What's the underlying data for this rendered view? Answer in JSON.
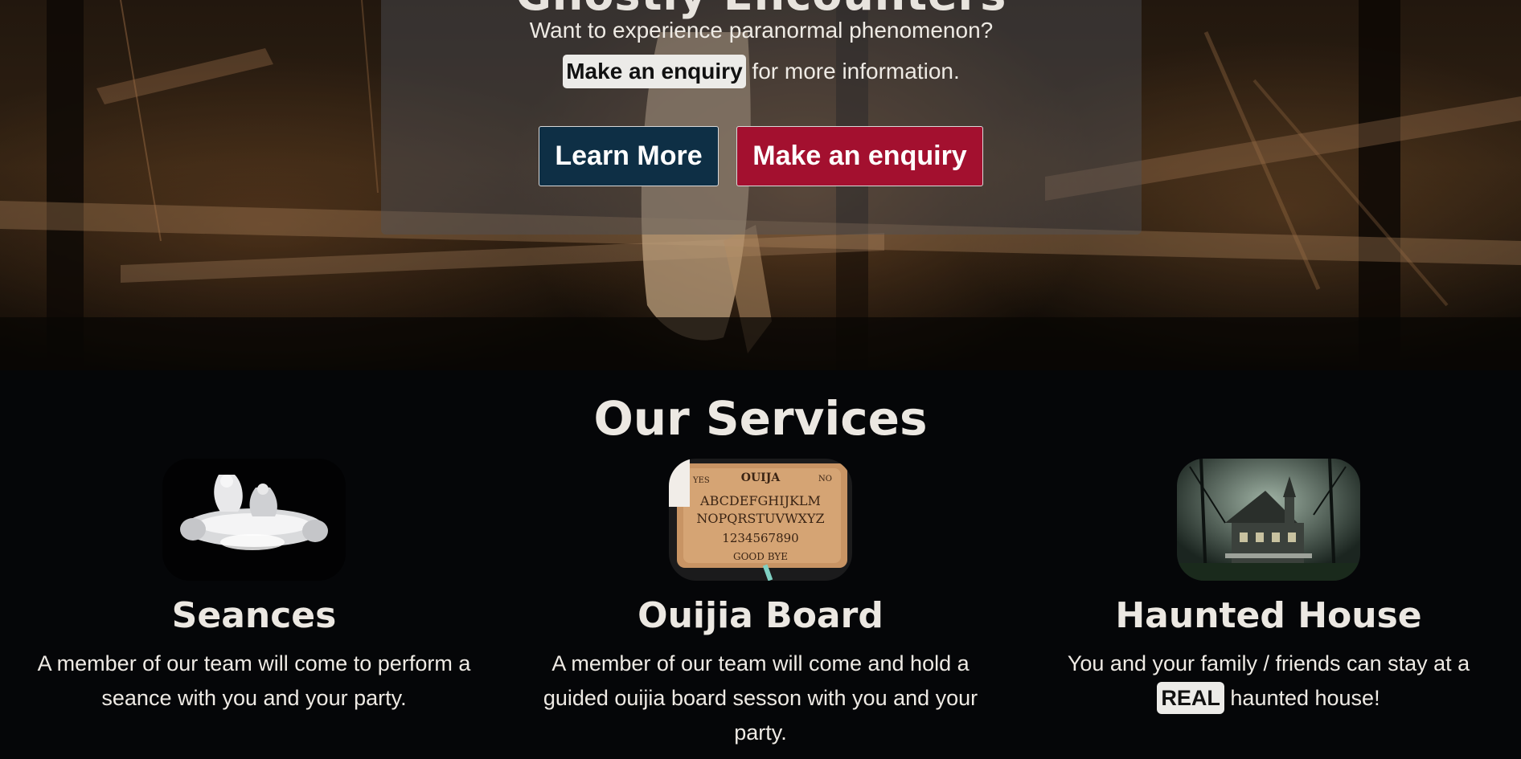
{
  "hero": {
    "title": "Ghostly Encounters",
    "subtitle": "Want to experience paranormal phenomenon?",
    "inline_link": "Make an enquiry",
    "line2_suffix": " for more information.",
    "buttons": {
      "learn_more": "Learn More",
      "enquiry": "Make an enquiry"
    }
  },
  "services": {
    "heading": "Our Services",
    "items": [
      {
        "name": "Seances",
        "description": "A member of our team will come to perform a seance with you and your party.",
        "image_icon": "seance-photo"
      },
      {
        "name": "Ouijia Board",
        "description": "A member of our team will come and hold a guided ouijia board sesson with you and your party.",
        "image_icon": "ouija-board-photo",
        "board_text": {
          "yes": "YES",
          "brand": "OUIJA",
          "no": "NO",
          "row1": "ABCDEFGHIJKLM",
          "row2": "NOPQRSTUVWXYZ",
          "row3": "1234567890",
          "bye": "GOOD BYE"
        }
      },
      {
        "name": "Haunted House",
        "description_prefix": "You and your family / friends can stay at a ",
        "description_tag": "REAL",
        "description_suffix": " haunted house!",
        "image_icon": "haunted-house-photo"
      }
    ]
  },
  "colors": {
    "learn_button": "#0e2f45",
    "enquiry_button": "#a3102f",
    "page_background": "#050608"
  }
}
